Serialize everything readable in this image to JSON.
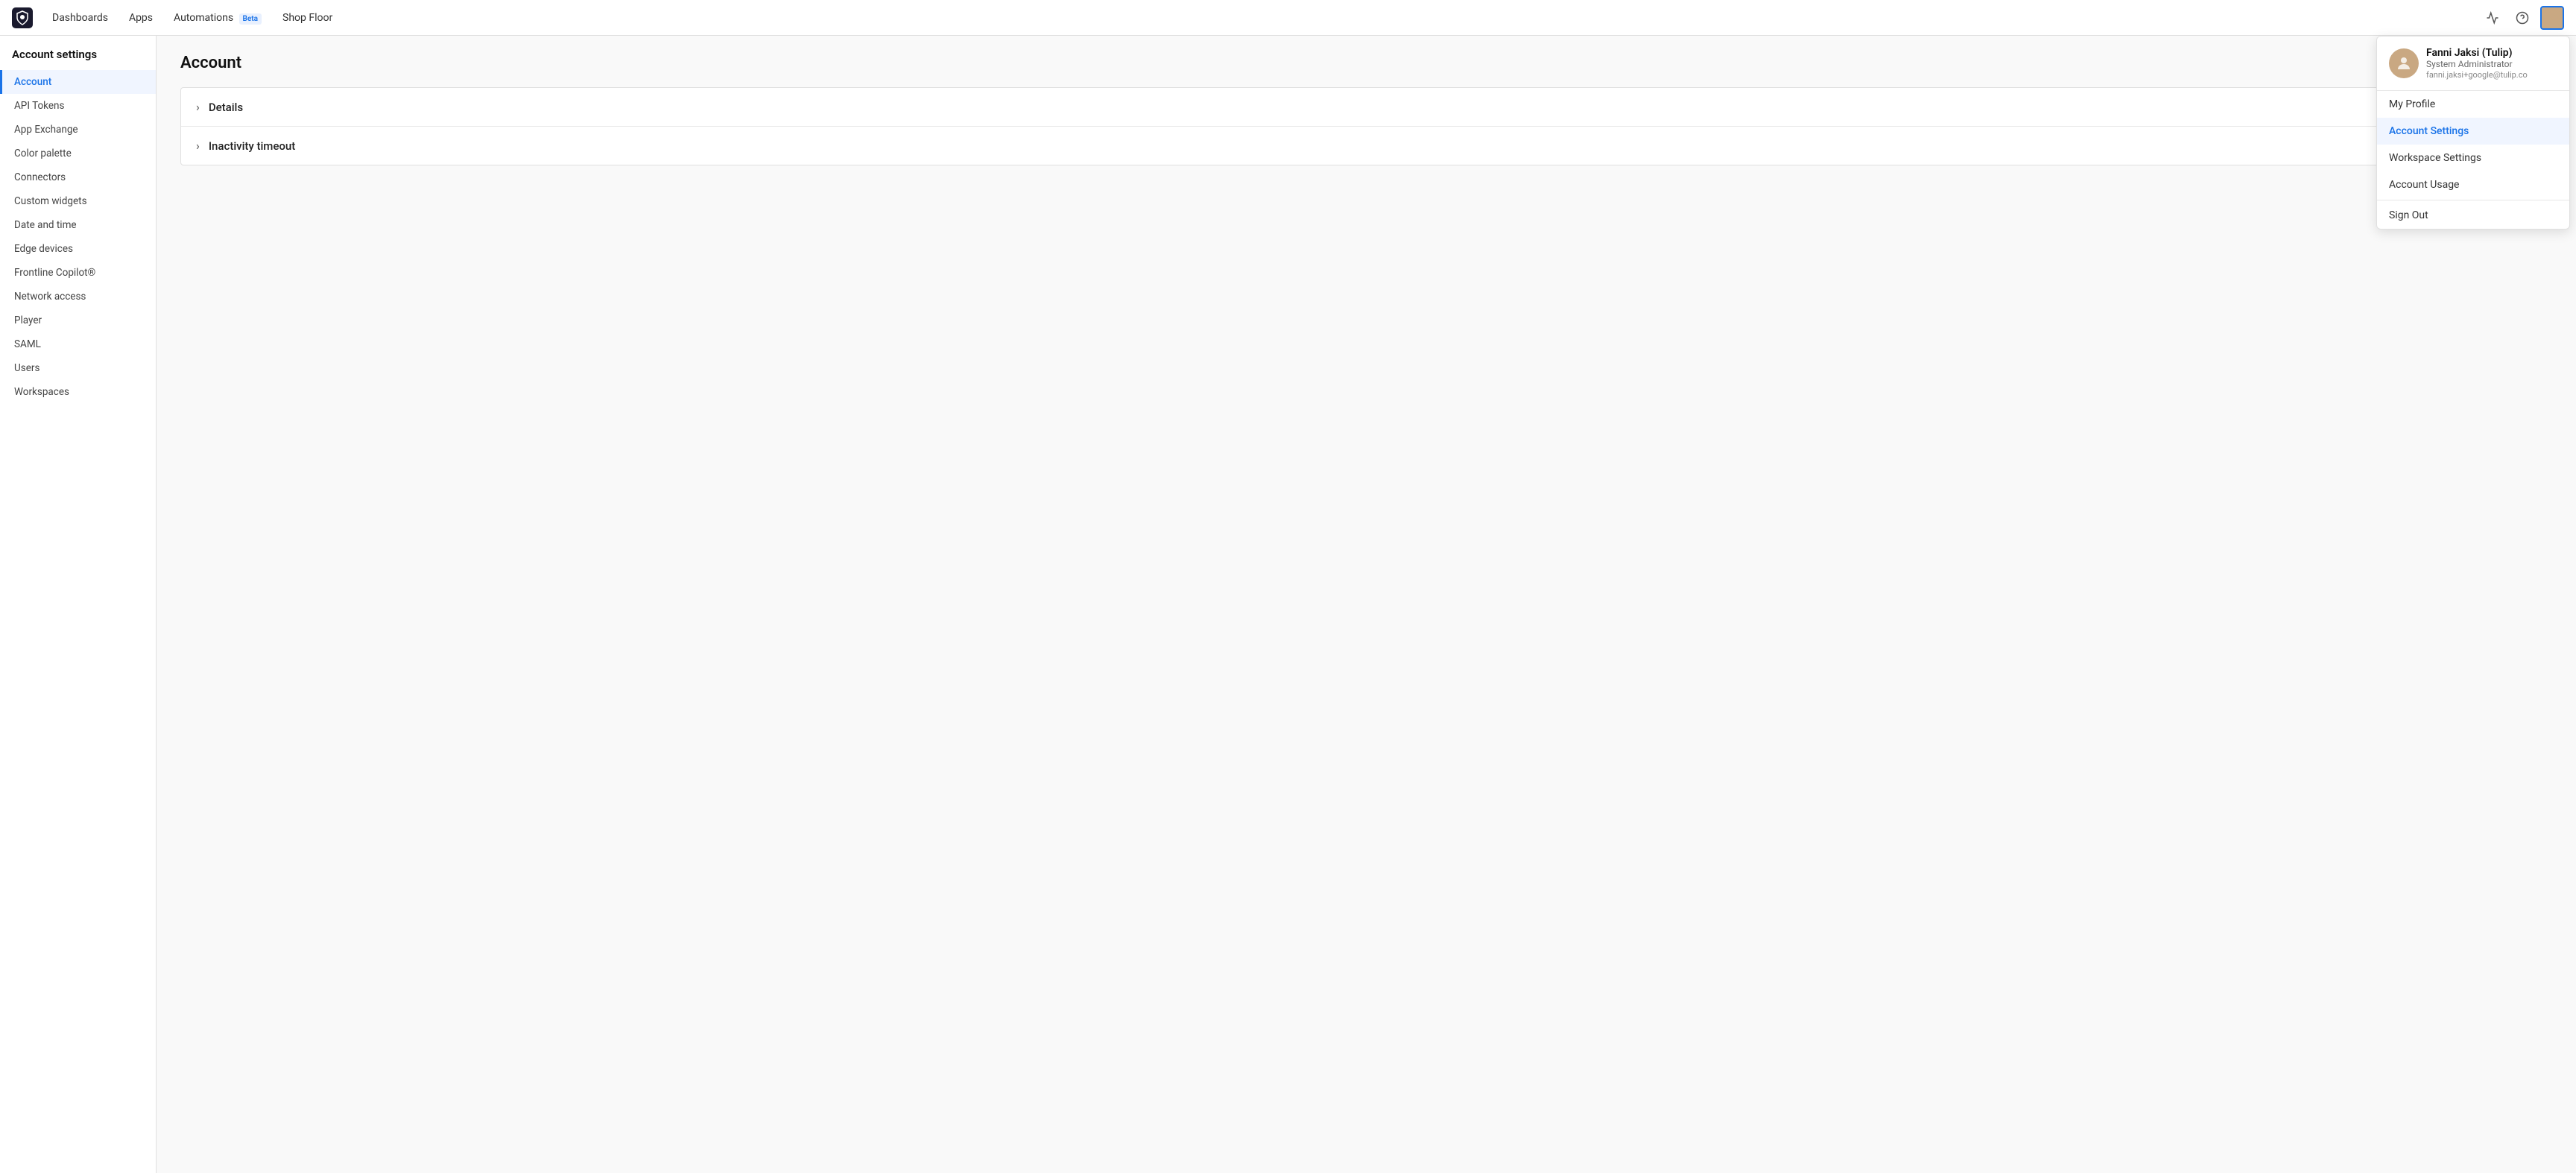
{
  "app": {
    "logo_alt": "Tulip Logo"
  },
  "topnav": {
    "links": [
      {
        "id": "dashboards",
        "label": "Dashboards",
        "beta": false
      },
      {
        "id": "apps",
        "label": "Apps",
        "beta": false
      },
      {
        "id": "automations",
        "label": "Automations",
        "beta": true
      },
      {
        "id": "shop-floor",
        "label": "Shop Floor",
        "beta": false
      }
    ],
    "beta_label": "Beta"
  },
  "sidebar": {
    "title": "Account settings",
    "items": [
      {
        "id": "account",
        "label": "Account",
        "active": true
      },
      {
        "id": "api-tokens",
        "label": "API Tokens",
        "active": false
      },
      {
        "id": "app-exchange",
        "label": "App Exchange",
        "active": false
      },
      {
        "id": "color-palette",
        "label": "Color palette",
        "active": false
      },
      {
        "id": "connectors",
        "label": "Connectors",
        "active": false
      },
      {
        "id": "custom-widgets",
        "label": "Custom widgets",
        "active": false
      },
      {
        "id": "date-and-time",
        "label": "Date and time",
        "active": false
      },
      {
        "id": "edge-devices",
        "label": "Edge devices",
        "active": false
      },
      {
        "id": "frontline-copilot",
        "label": "Frontline Copilot®",
        "active": false
      },
      {
        "id": "network-access",
        "label": "Network access",
        "active": false
      },
      {
        "id": "player",
        "label": "Player",
        "active": false
      },
      {
        "id": "saml",
        "label": "SAML",
        "active": false
      },
      {
        "id": "users",
        "label": "Users",
        "active": false
      },
      {
        "id": "workspaces",
        "label": "Workspaces",
        "active": false
      }
    ]
  },
  "main": {
    "page_title": "Account",
    "sections": [
      {
        "id": "details",
        "label": "Details"
      },
      {
        "id": "inactivity-timeout",
        "label": "Inactivity timeout"
      }
    ]
  },
  "dropdown": {
    "user": {
      "name": "Fanni Jaksi (Tulip)",
      "role": "System Administrator",
      "email": "fanni.jaksi+google@tulip.co"
    },
    "items": [
      {
        "id": "my-profile",
        "label": "My Profile",
        "active": false
      },
      {
        "id": "account-settings",
        "label": "Account Settings",
        "active": true
      },
      {
        "id": "workspace-settings",
        "label": "Workspace Settings",
        "active": false
      },
      {
        "id": "account-usage",
        "label": "Account Usage",
        "active": false
      },
      {
        "id": "sign-out",
        "label": "Sign Out",
        "active": false
      }
    ]
  }
}
